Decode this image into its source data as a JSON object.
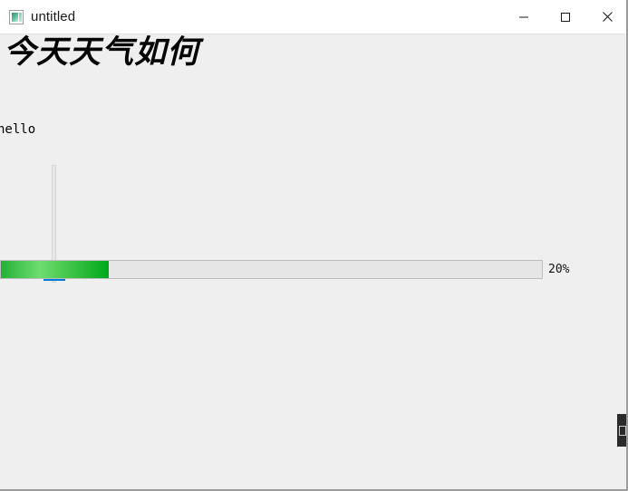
{
  "window": {
    "title": "untitled",
    "icon": "app-window-icon",
    "controls": {
      "minimize_label": "─",
      "maximize_label": "□",
      "close_label": "✕"
    },
    "colors": {
      "titlebar_bg": "#ffffff",
      "client_bg": "#efefef",
      "accent_blue": "#0078d7",
      "progress_green_light": "#6fdd71",
      "progress_green_dark": "#00a81b"
    }
  },
  "content": {
    "cjk_text": "今天天气如何",
    "hello_text": "hello"
  },
  "slider": {
    "orientation": "vertical",
    "value_position": "bottom",
    "handle_color": "#0078d7",
    "track_color": "#e6e8e8"
  },
  "progress": {
    "percent": 20,
    "percent_label": "20%",
    "fill_color": "#22b035",
    "track_color": "#e6e6e6"
  }
}
